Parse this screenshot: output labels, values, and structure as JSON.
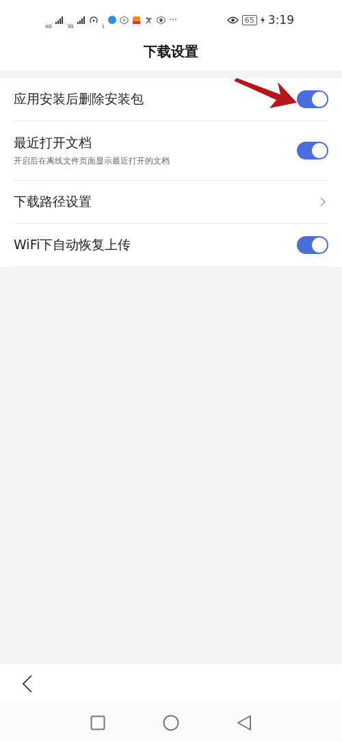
{
  "status_bar": {
    "signal_1": "4G",
    "signal_2": "3G",
    "hotspot_count": "1",
    "more": "···",
    "battery": "65",
    "time": "3:19"
  },
  "title": "下载设置",
  "settings": [
    {
      "kind": "toggle",
      "label": "应用安装后删除安装包",
      "on": true
    },
    {
      "kind": "toggle",
      "label": "最近打开文档",
      "subtitle": "开启后在离线文件页面显示最近打开的文档",
      "on": true
    },
    {
      "kind": "link",
      "label": "下载路径设置"
    },
    {
      "kind": "toggle",
      "label": "WiFi下自动恢复上传",
      "on": true
    }
  ]
}
